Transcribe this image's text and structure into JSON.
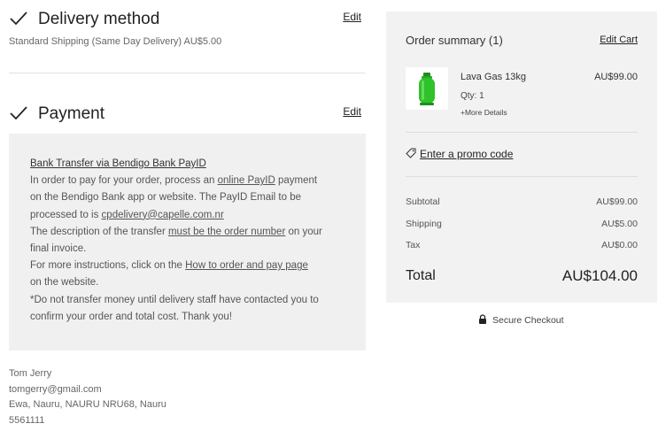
{
  "delivery": {
    "title": "Delivery method",
    "edit_label": "Edit",
    "selected": "Standard Shipping (Same Day Delivery) AU$5.00"
  },
  "payment": {
    "title": "Payment",
    "edit_label": "Edit",
    "method_title": "Bank Transfer via Bendigo Bank PayID",
    "line1_pre": "In order to pay for your order, process an ",
    "line1_link": "online PayID",
    "line1_post": " payment",
    "line2_pre": "on the Bendigo Bank app or website. The PayID Email to be",
    "line3_pre": "processed to is ",
    "line3_link": "cpdelivery@capelle.com.nr",
    "line4_pre": "The description of the transfer ",
    "line4_link": "must be the order number",
    "line4_post": " on your",
    "line5": "final invoice.",
    "line6_pre": "For more instructions, click on the ",
    "line6_link": "How to order and pay page",
    "line7": "on the website.",
    "line8": "*Do not transfer money until delivery staff have contacted you to",
    "line9": "confirm your order and total cost. Thank you!"
  },
  "address": {
    "name": "Tom Jerry",
    "email": "tomgerry@gmail.com",
    "location": "Ewa, Nauru, NAURU NRU68, Nauru",
    "phone": "5561111"
  },
  "summary": {
    "title": "Order summary (1)",
    "edit_cart_label": "Edit Cart",
    "product": {
      "name": "Lava Gas 13kg",
      "price": "AU$99.00",
      "qty": "Qty: 1",
      "more": "+More Details",
      "icon": "gas-cylinder-icon",
      "color": "#2fc22a"
    },
    "promo_label": "Enter a promo code",
    "subtotal_label": "Subtotal",
    "subtotal_value": "AU$99.00",
    "shipping_label": "Shipping",
    "shipping_value": "AU$5.00",
    "tax_label": "Tax",
    "tax_value": "AU$0.00",
    "total_label": "Total",
    "total_value": "AU$104.00"
  },
  "secure_checkout": "Secure Checkout"
}
